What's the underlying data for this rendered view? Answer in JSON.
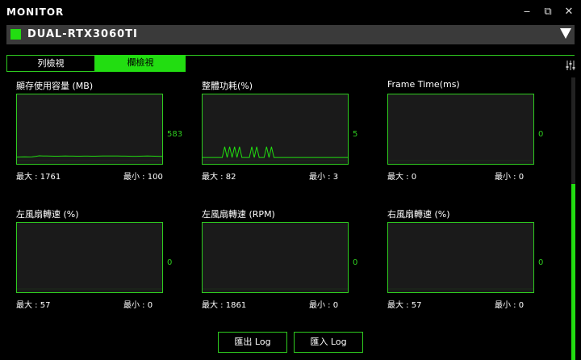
{
  "app": {
    "title": "MONITOR"
  },
  "window_controls": {
    "minimize": "‒",
    "maximize": "⧉",
    "close": "✕"
  },
  "device": {
    "name": "DUAL-RTX3060TI",
    "swatch_color": "#22dd11"
  },
  "tabs": [
    {
      "label": "列檢視",
      "active": false
    },
    {
      "label": "欄檢視",
      "active": true
    }
  ],
  "colors": {
    "accent": "#2ecc1f",
    "graph_bg": "#1a1a1a",
    "line": "#22dd11"
  },
  "panels": [
    {
      "title": "顯存使用容量 (MB)",
      "current": "583",
      "max_label": "最大 : 1761",
      "min_label": "最小 : 100"
    },
    {
      "title": "整體功耗(%)",
      "current": "5",
      "max_label": "最大 : 82",
      "min_label": "最小 : 3"
    },
    {
      "title": "Frame Time(ms)",
      "current": "0",
      "max_label": "最大 : 0",
      "min_label": "最小 : 0"
    },
    {
      "title": "左風扇轉速 (%)",
      "current": "0",
      "max_label": "最大 : 57",
      "min_label": "最小 : 0"
    },
    {
      "title": "左風扇轉速 (RPM)",
      "current": "0",
      "max_label": "最大 : 1861",
      "min_label": "最小 : 0"
    },
    {
      "title": "右風扇轉速 (%)",
      "current": "0",
      "max_label": "最大 : 57",
      "min_label": "最小 : 0"
    }
  ],
  "chart_data": [
    {
      "type": "line",
      "title": "顯存使用容量 (MB)",
      "ylim": [
        0,
        1761
      ],
      "values": [
        100,
        102,
        103,
        101,
        104,
        120,
        135,
        130,
        128,
        126,
        124,
        125,
        126,
        128,
        127,
        126,
        125,
        124,
        126,
        127,
        125,
        124,
        126,
        128,
        130,
        132,
        130,
        128,
        127,
        126,
        124,
        123,
        122,
        124,
        126,
        128,
        126,
        124,
        122,
        120
      ]
    },
    {
      "type": "line",
      "title": "整體功耗(%)",
      "ylim": [
        0,
        100
      ],
      "values": [
        5,
        5,
        5,
        5,
        5,
        5,
        5,
        5,
        5,
        22,
        5,
        22,
        5,
        22,
        5,
        22,
        5,
        5,
        5,
        5,
        22,
        5,
        22,
        5,
        5,
        5,
        22,
        5,
        22,
        5,
        5,
        5,
        5,
        5,
        5,
        5,
        5,
        5,
        5,
        5,
        5,
        5,
        5,
        5,
        5,
        5,
        5,
        5,
        5,
        5,
        5,
        5,
        5,
        5,
        5,
        5,
        5,
        5,
        5,
        5
      ]
    },
    {
      "type": "line",
      "title": "Frame Time(ms)",
      "ylim": [
        0,
        1
      ],
      "values": []
    },
    {
      "type": "line",
      "title": "左風扇轉速 (%)",
      "ylim": [
        0,
        100
      ],
      "values": []
    },
    {
      "type": "line",
      "title": "左風扇轉速 (RPM)",
      "ylim": [
        0,
        2000
      ],
      "values": []
    },
    {
      "type": "line",
      "title": "右風扇轉速 (%)",
      "ylim": [
        0,
        100
      ],
      "values": []
    }
  ],
  "buttons": {
    "export": "匯出 Log",
    "import": "匯入 Log"
  }
}
